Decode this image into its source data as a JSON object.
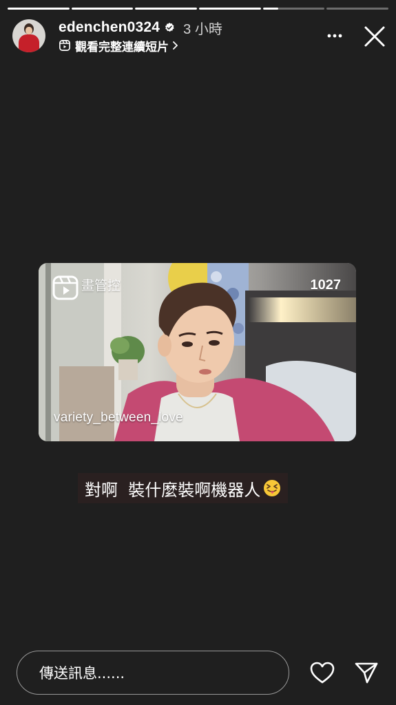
{
  "story": {
    "segments_total": 6,
    "segments_complete": 4,
    "current_segment_progress": 0.25
  },
  "header": {
    "username": "edenchen0324",
    "verified": true,
    "time_ago": "3 小時",
    "sub_label": "觀看完整連續短片",
    "icons": {
      "verified": "verified-badge-icon",
      "reels": "reels-icon",
      "chevron": "chevron-right-icon",
      "more": "more-horizontal-icon",
      "close": "close-icon"
    }
  },
  "media": {
    "handle_watermark": "variety_between_love",
    "channel_logo_text": "畫管控",
    "episode_tag": "1027"
  },
  "caption": {
    "text": "對啊  裝什麼裝啊機器人",
    "emoji": "squinting-face-with-tongue"
  },
  "footer": {
    "message_placeholder": "傳送訊息......",
    "icons": {
      "like": "heart-icon",
      "send": "send-icon"
    }
  },
  "colors": {
    "background": "#1f1f1f",
    "caption_bg": "#2a2020",
    "text": "#ffffff"
  }
}
